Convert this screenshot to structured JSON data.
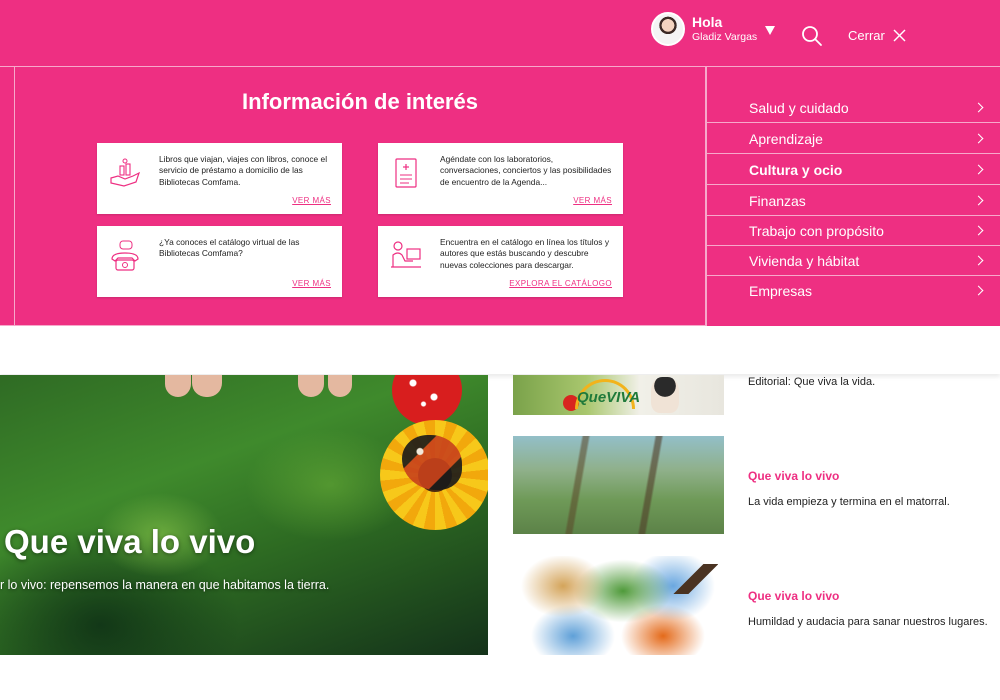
{
  "header": {
    "greeting": "Hola",
    "user_name": "Gladiz Vargas",
    "close_label": "Cerrar",
    "icons": {
      "search": "search-icon",
      "close": "close-icon",
      "dropdown": "caret-down-icon"
    },
    "colors": {
      "brand": "#ee2f82",
      "divider": "#f7a8cb"
    }
  },
  "info": {
    "title": "Información de interés",
    "cards": [
      {
        "text": "Libros que viajan, viajes con libros, conoce el servicio de préstamo a domicilio de las Bibliotecas Comfama.",
        "link": "VER MÁS",
        "icon": "hand-books-icon"
      },
      {
        "text": "Agéndate con los laboratorios, conversaciones, conciertos y las posibilidades de encuentro de la Agenda...",
        "link": "VER MÁS",
        "icon": "document-icon"
      },
      {
        "text": "¿Ya conoces el catálogo virtual de las Bibliotecas Comfama?",
        "link": "VER MÁS",
        "icon": "phone-chat-icon"
      },
      {
        "text": "Encuentra en el catálogo en línea los títulos y autores que estás buscando y descubre nuevas colecciones para descargar.",
        "link": "EXPLORA EL CATÁLOGO",
        "icon": "person-laptop-icon"
      }
    ]
  },
  "categories": [
    {
      "label": "Salud y cuidado",
      "bold": false
    },
    {
      "label": "Aprendizaje",
      "bold": false
    },
    {
      "label": "Cultura y ocio",
      "bold": true
    },
    {
      "label": "Finanzas",
      "bold": false
    },
    {
      "label": "Trabajo con propósito",
      "bold": false
    },
    {
      "label": "Vivienda y hábitat",
      "bold": false
    },
    {
      "label": "Empresas",
      "bold": false
    }
  ],
  "hero": {
    "title": "Que viva lo vivo",
    "subtitle": "r lo vivo: repensemos la manera en que habitamos la tierra."
  },
  "articles": [
    {
      "category": "",
      "description": "Editorial: Que viva la vida.",
      "thumb_text": "QueVIVA"
    },
    {
      "category": "Que viva lo vivo",
      "description": "La vida empieza y termina en el matorral."
    },
    {
      "category": "Que viva lo vivo",
      "description": "Humildad y audacia para sanar nuestros lugares."
    }
  ]
}
